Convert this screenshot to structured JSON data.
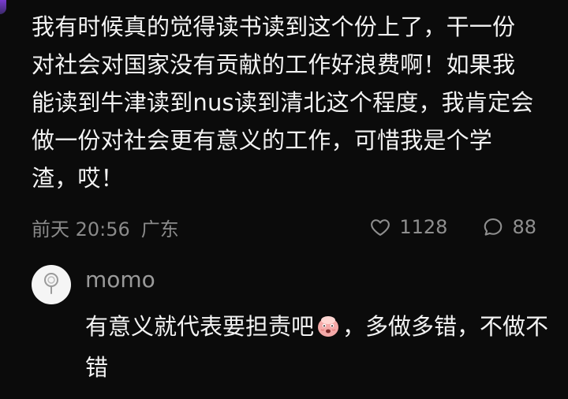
{
  "post": {
    "text": "我有时候真的觉得读书读到这个份上了，干一份对社会对国家没有贡献的工作好浪费啊！如果我能读到牛津读到nus读到清北这个程度，我肯定会做一份对社会更有意义的工作，可惜我是个学渣，哎！",
    "date": "前天 20:56",
    "location": "广东",
    "like_count": "1128",
    "comment_count": "88"
  },
  "reply": {
    "username": "momo",
    "text_before_emoji": "有意义就代表要担责吧",
    "emoji": "scared-face-emoji",
    "text_after_emoji": "，多做多错，不做不错"
  },
  "icons": {
    "like": "heart-outline-icon",
    "comment": "speech-bubble-icon",
    "avatar": "lollipop-icon"
  },
  "colors": {
    "background": "#0b0b0b",
    "text_primary": "#f3f3f3",
    "text_secondary": "#8a8a8a"
  }
}
